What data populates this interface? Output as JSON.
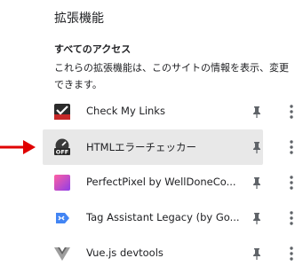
{
  "header": {
    "title": "拡張機能"
  },
  "access": {
    "title": "すべてのアクセス",
    "description": "これらの拡張機能は、このサイトの情報を表示、変更できます。"
  },
  "extensions": [
    {
      "name": "Check My Links",
      "icon": "check-my-links-icon"
    },
    {
      "name": "HTMLエラーチェッカー",
      "icon": "html-error-checker-icon",
      "badge": "OFF"
    },
    {
      "name": "PerfectPixel by WellDoneCo...",
      "icon": "perfectpixel-icon"
    },
    {
      "name": "Tag Assistant Legacy (by Go...",
      "icon": "tag-assistant-icon"
    },
    {
      "name": "Vue.js devtools",
      "icon": "vuejs-icon"
    }
  ],
  "colors": {
    "arrow": "#e00000",
    "highlight": "#e8e8e8"
  }
}
